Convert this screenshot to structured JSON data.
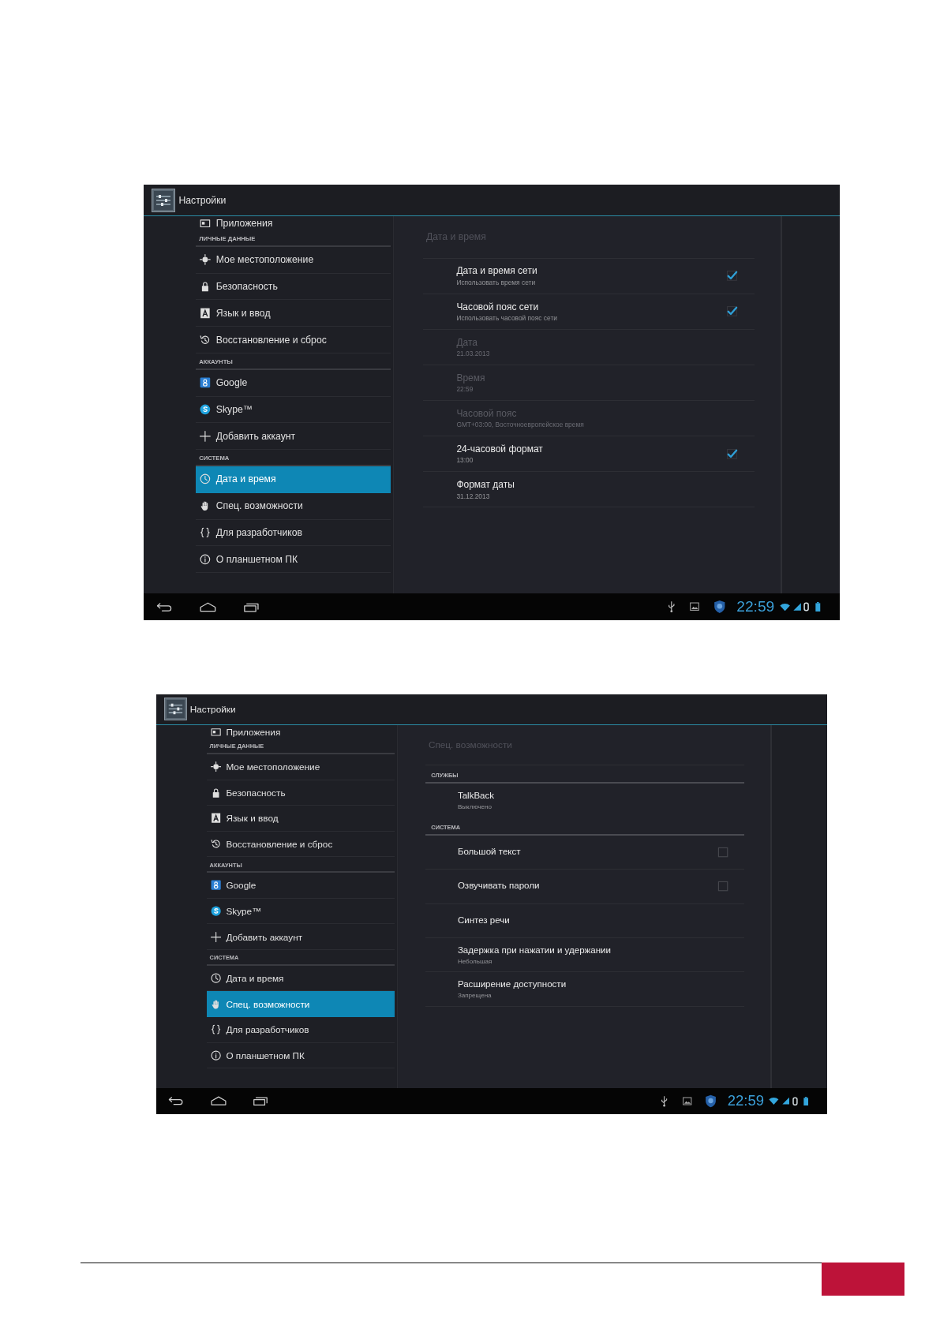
{
  "screenshots": [
    {
      "action_bar": {
        "title": "Настройки"
      },
      "sidebar": {
        "items": [
          {
            "kind": "item",
            "label": "Приложения",
            "selected": false
          },
          {
            "kind": "header",
            "label": "ЛИЧНЫЕ ДАННЫЕ"
          },
          {
            "kind": "item",
            "label": "Мое местоположение",
            "selected": false
          },
          {
            "kind": "item",
            "label": "Безопасность",
            "selected": false
          },
          {
            "kind": "item",
            "label": "Язык и ввод",
            "selected": false
          },
          {
            "kind": "item",
            "label": "Восстановление и сброс",
            "selected": false
          },
          {
            "kind": "header",
            "label": "АККАУНТЫ"
          },
          {
            "kind": "item",
            "label": "Google",
            "selected": false
          },
          {
            "kind": "item",
            "label": "Skype™",
            "selected": false
          },
          {
            "kind": "item",
            "label": "Добавить аккаунт",
            "selected": false
          },
          {
            "kind": "header",
            "label": "СИСТЕМА"
          },
          {
            "kind": "item",
            "label": "Дата и время",
            "selected": true
          },
          {
            "kind": "item",
            "label": "Спец. возможности",
            "selected": false
          },
          {
            "kind": "item",
            "label": "Для разработчиков",
            "selected": false
          },
          {
            "kind": "item",
            "label": "О планшетном ПК",
            "selected": false
          }
        ]
      },
      "detail": {
        "title": "Дата и время",
        "items": [
          {
            "kind": "checkbox",
            "title": "Дата и время сети",
            "summary": "Использовать время сети",
            "disabled": false,
            "checked": true
          },
          {
            "kind": "checkbox",
            "title": "Часовой пояс сети",
            "summary": "Использовать часовой пояс сети",
            "disabled": false,
            "checked": true
          },
          {
            "kind": "plain",
            "title": "Дата",
            "summary": "21.03.2013",
            "disabled": true
          },
          {
            "kind": "plain",
            "title": "Время",
            "summary": "22:59",
            "disabled": true
          },
          {
            "kind": "plain",
            "title": "Часовой пояс",
            "summary": "GMT+03:00, Восточноевропейское время",
            "disabled": true
          },
          {
            "kind": "checkbox",
            "title": "24-часовой формат",
            "summary": "13:00",
            "disabled": false,
            "checked": true
          },
          {
            "kind": "plain",
            "title": "Формат даты",
            "summary": "31.12.2013",
            "disabled": false
          }
        ]
      },
      "status_bar": {
        "time": "22:59"
      }
    },
    {
      "action_bar": {
        "title": "Настройки"
      },
      "sidebar": {
        "items": [
          {
            "kind": "item",
            "label": "Приложения",
            "selected": false
          },
          {
            "kind": "header",
            "label": "ЛИЧНЫЕ ДАННЫЕ"
          },
          {
            "kind": "item",
            "label": "Мое местоположение",
            "selected": false
          },
          {
            "kind": "item",
            "label": "Безопасность",
            "selected": false
          },
          {
            "kind": "item",
            "label": "Язык и ввод",
            "selected": false
          },
          {
            "kind": "item",
            "label": "Восстановление и сброс",
            "selected": false
          },
          {
            "kind": "header",
            "label": "АККАУНТЫ"
          },
          {
            "kind": "item",
            "label": "Google",
            "selected": false
          },
          {
            "kind": "item",
            "label": "Skype™",
            "selected": false
          },
          {
            "kind": "item",
            "label": "Добавить аккаунт",
            "selected": false
          },
          {
            "kind": "header",
            "label": "СИСТЕМА"
          },
          {
            "kind": "item",
            "label": "Дата и время",
            "selected": false
          },
          {
            "kind": "item",
            "label": "Спец. возможности",
            "selected": true
          },
          {
            "kind": "item",
            "label": "Для разработчиков",
            "selected": false
          },
          {
            "kind": "item",
            "label": "О планшетном ПК",
            "selected": false
          }
        ]
      },
      "detail": {
        "title": "Спец. возможности",
        "items": [
          {
            "kind": "header",
            "title": "СЛУЖБЫ"
          },
          {
            "kind": "plain",
            "title": "TalkBack",
            "summary": "Выключено",
            "disabled": false
          },
          {
            "kind": "header",
            "title": "СИСТЕМА"
          },
          {
            "kind": "checkbox",
            "title": "Большой текст",
            "disabled": false,
            "checked": false
          },
          {
            "kind": "checkbox",
            "title": "Озвучивать пароли",
            "disabled": false,
            "checked": false
          },
          {
            "kind": "plain",
            "title": "Синтез речи",
            "disabled": false
          },
          {
            "kind": "plain",
            "title": "Задержка при нажатии и удержании",
            "summary": "Небольшая",
            "disabled": false
          },
          {
            "kind": "plain",
            "title": "Расширение доступности",
            "summary": "Запрещена",
            "disabled": false
          }
        ]
      },
      "status_bar": {
        "time": "22:59"
      }
    }
  ]
}
